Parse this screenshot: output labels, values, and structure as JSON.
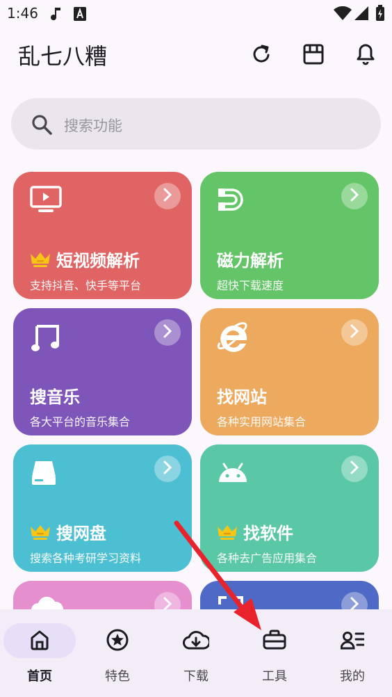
{
  "status_bar": {
    "time": "1:46"
  },
  "app_bar": {
    "title": "乱七八糟",
    "icons": [
      "refresh-icon",
      "store-icon",
      "bell-icon"
    ]
  },
  "search": {
    "placeholder": "搜索功能"
  },
  "cards": [
    {
      "title": "短视频解析",
      "subtitle": "支持抖音、快手等平台",
      "icon": "tv-icon",
      "premium": true,
      "color": "#e06464"
    },
    {
      "title": "磁力解析",
      "subtitle": "超快下载速度",
      "icon": "magnet-icon",
      "premium": false,
      "color": "#63c567"
    },
    {
      "title": "搜音乐",
      "subtitle": "各大平台的音乐集合",
      "icon": "music-note-icon",
      "premium": false,
      "color": "#7e55b8"
    },
    {
      "title": "找网站",
      "subtitle": "各种实用网站集合",
      "icon": "ie-browser-icon",
      "premium": false,
      "color": "#eda95e"
    },
    {
      "title": "搜网盘",
      "subtitle": "搜索各种考研学习资料",
      "icon": "hard-drive-icon",
      "premium": true,
      "color": "#4dbfd3"
    },
    {
      "title": "找软件",
      "subtitle": "各种去广告应用集合",
      "icon": "android-icon",
      "premium": true,
      "color": "#5ac8a7"
    },
    {
      "title": "",
      "subtitle": "",
      "icon": "cloud-icon",
      "premium": false,
      "color": "#e58fcf"
    },
    {
      "title": "",
      "subtitle": "",
      "icon": "scan-icon",
      "premium": false,
      "color": "#4f69c6"
    }
  ],
  "bottom_nav": {
    "items": [
      {
        "label": "首页",
        "icon": "home-icon",
        "active": true
      },
      {
        "label": "特色",
        "icon": "star-circle-icon",
        "active": false
      },
      {
        "label": "下载",
        "icon": "cloud-download-icon",
        "active": false
      },
      {
        "label": "工具",
        "icon": "toolbox-icon",
        "active": false
      },
      {
        "label": "我的",
        "icon": "profile-icon",
        "active": false
      }
    ]
  },
  "colors": {
    "accent": "#e7def8",
    "annotation_arrow": "#e8232b"
  }
}
